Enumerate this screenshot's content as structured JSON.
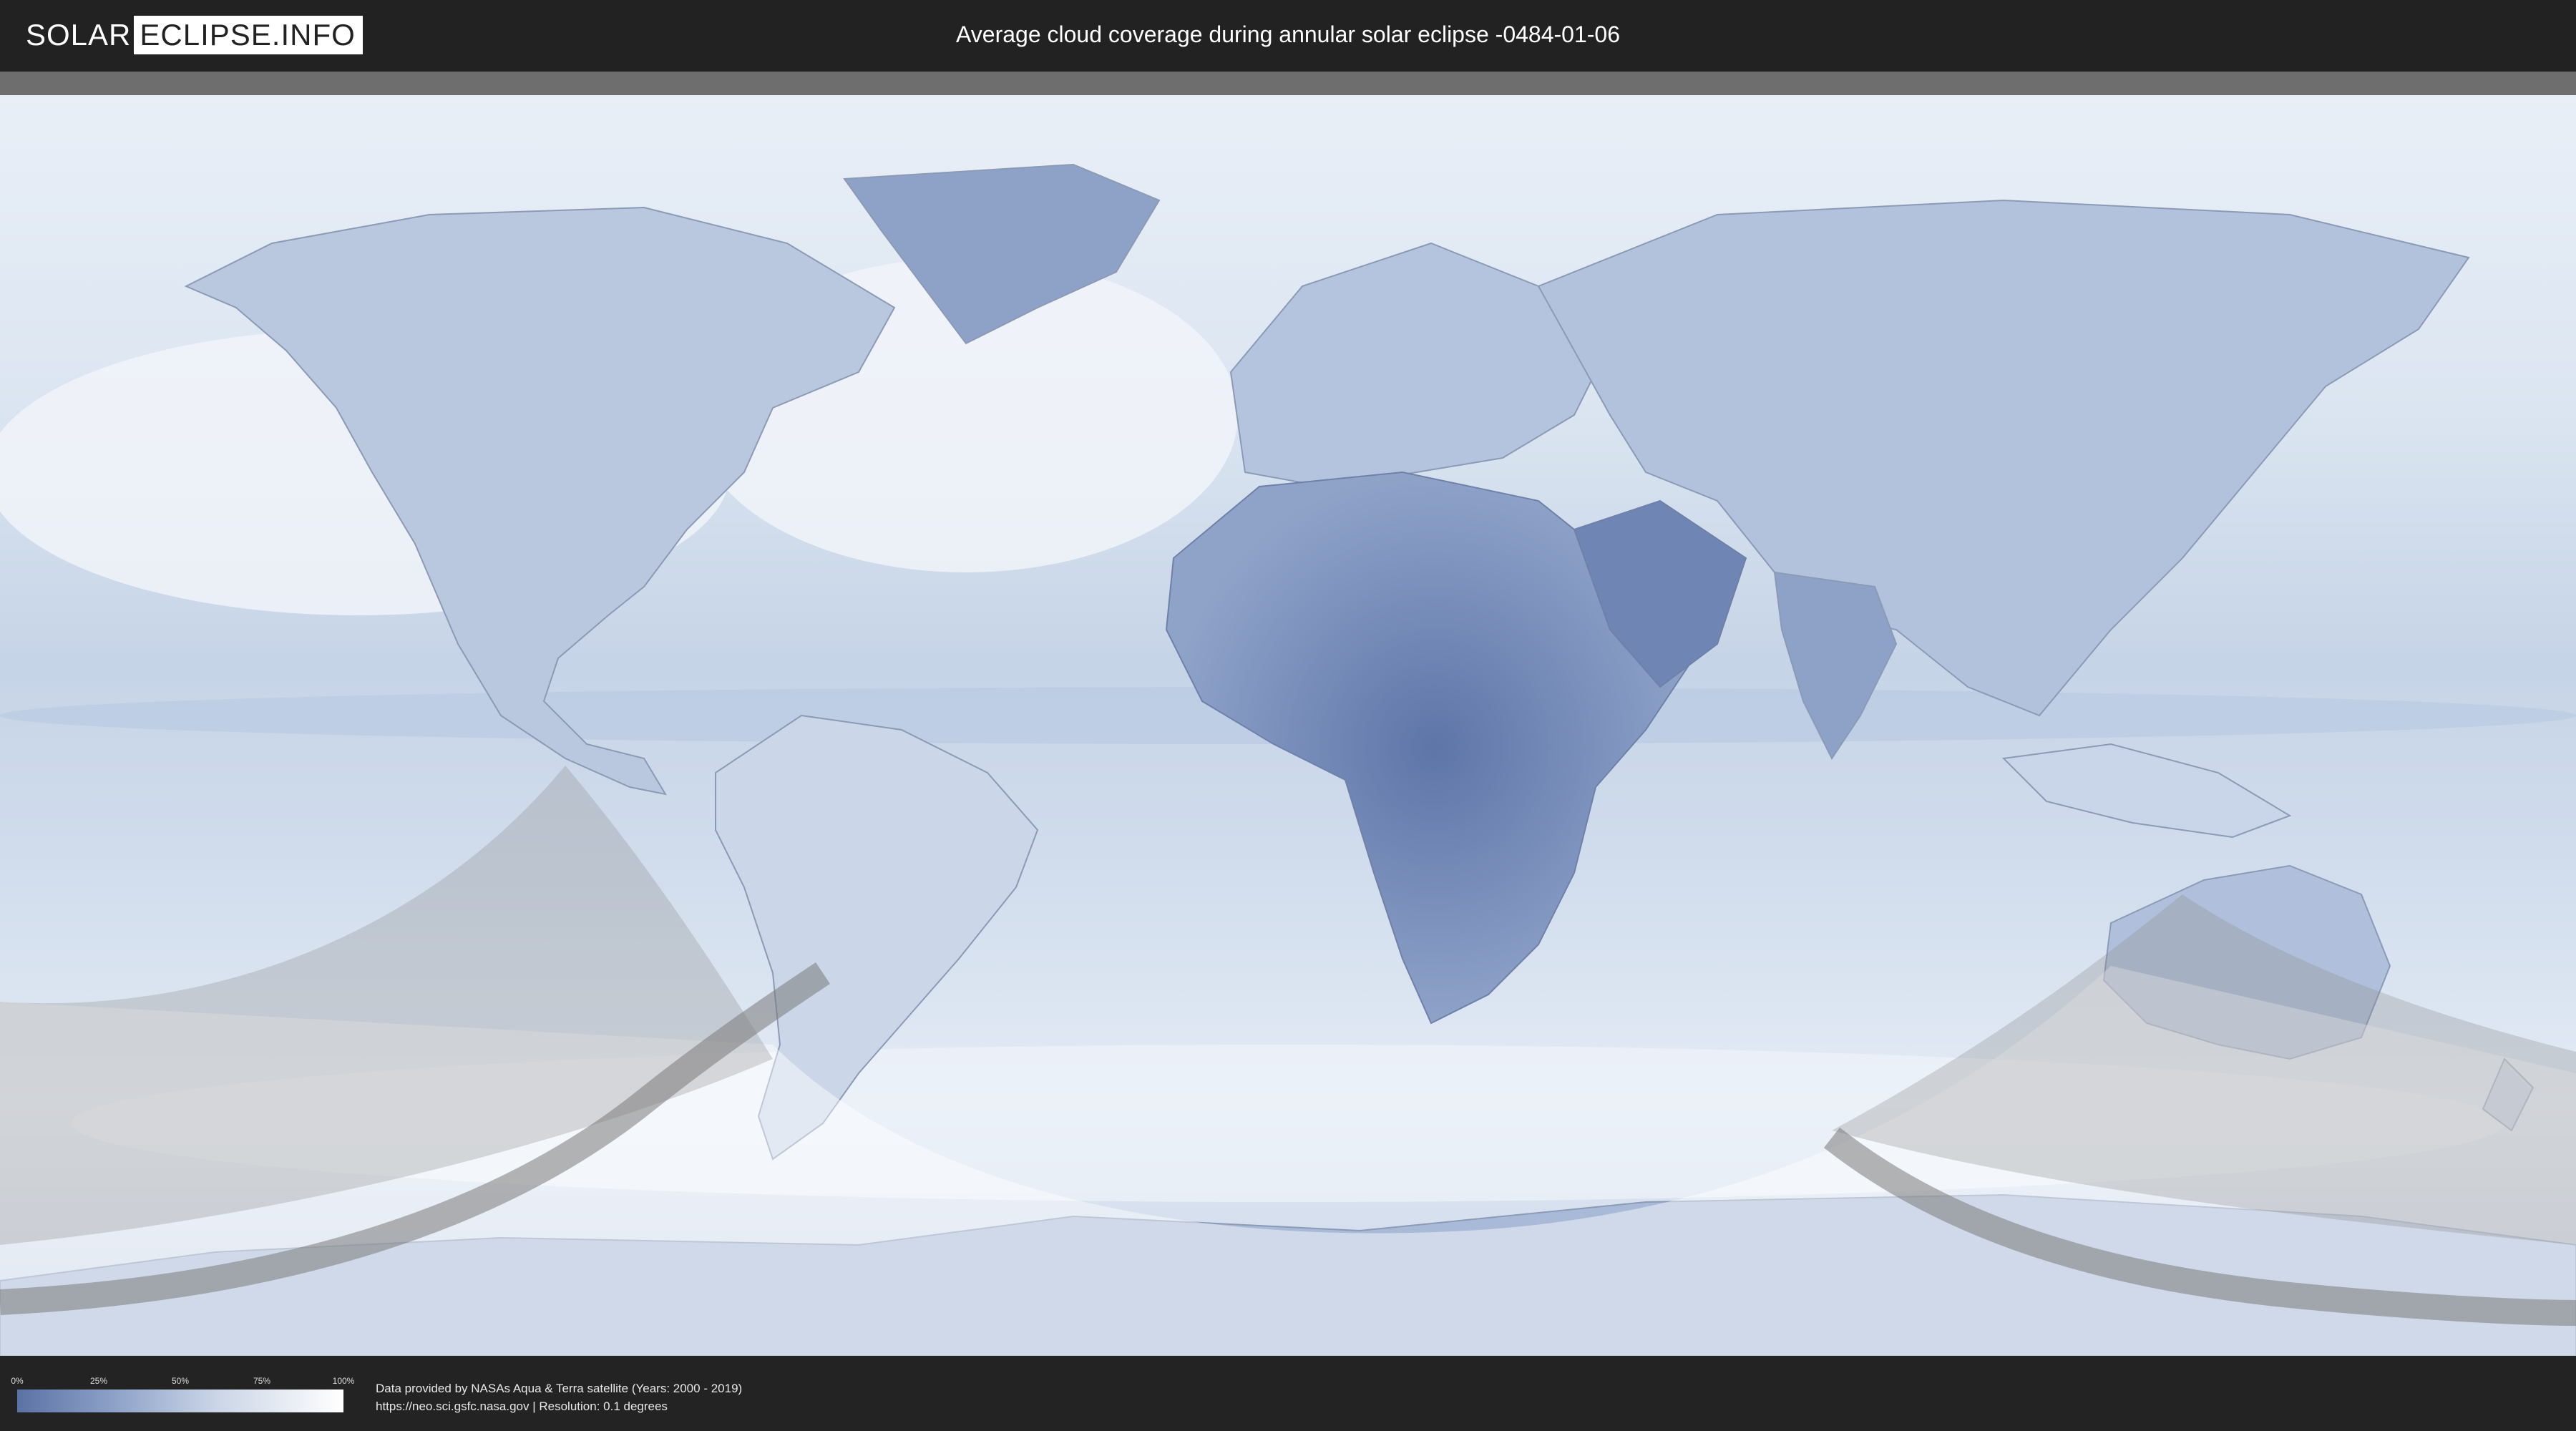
{
  "header": {
    "logo_left": "SOLAR",
    "logo_right": "ECLIPSE.INFO",
    "title": "Average cloud coverage during annular solar eclipse -0484-01-06"
  },
  "legend": {
    "ticks": [
      "0%",
      "25%",
      "50%",
      "75%",
      "100%"
    ],
    "tick_fractions": [
      0,
      0.25,
      0.5,
      0.75,
      1.0
    ],
    "gradient_colors": [
      "#5b72a5",
      "#8ea2c8",
      "#c9d4e6",
      "#ffffff"
    ]
  },
  "footer": {
    "line1": "Data provided by NASAs Aqua & Terra satellite (Years: 2000 - 2019)",
    "line2": "https://neo.sci.gsfc.nasa.gov | Resolution: 0.1 degrees"
  },
  "colors": {
    "ocean": "#c5d3e6",
    "land": "#9fb3d3",
    "dry_land": "#7388b5",
    "ice": "#dde6f2",
    "shadow": "#8c8c8c",
    "visibility_zone": "#ffffff"
  }
}
